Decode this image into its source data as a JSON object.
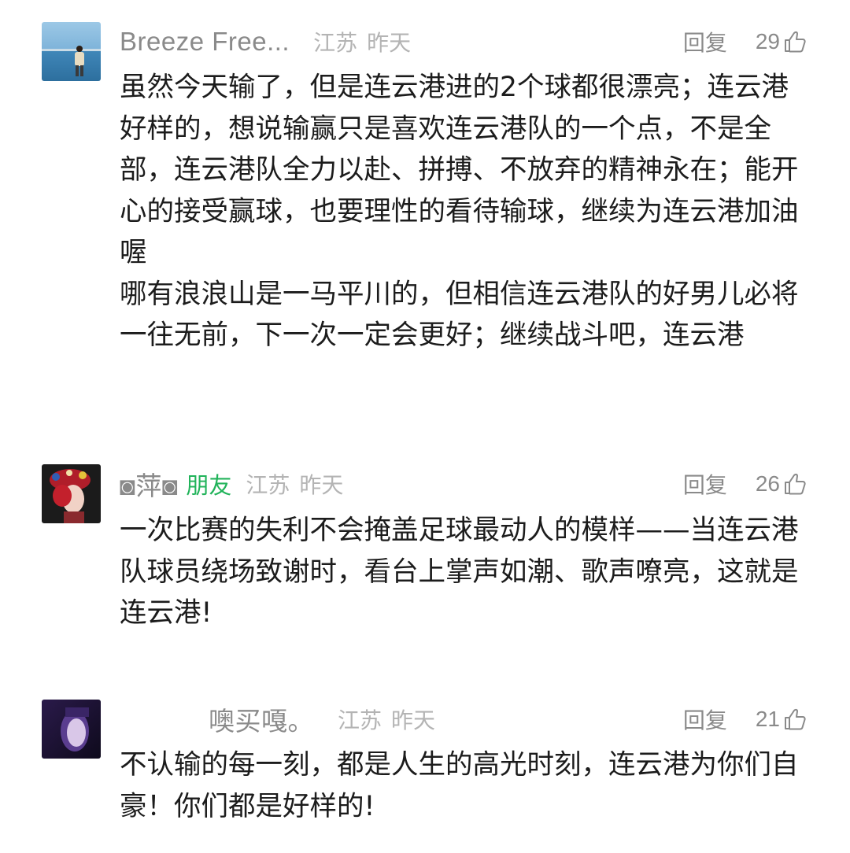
{
  "comments": [
    {
      "name": "Breeze Free...",
      "friend_badge": "",
      "location": "江苏",
      "time": "昨天",
      "reply_label": "回复",
      "likes": "29",
      "text": "虽然今天输了，但是连云港进的2个球都很漂亮；连云港好样的，想说输赢只是喜欢连云港队的一个点，不是全部，连云港队全力以赴、拼搏、不放弃的精神永在；能开心的接受赢球，也要理性的看待输球，继续为连云港加油喔\n哪有浪浪山是一马平川的，但相信连云港队的好男儿必将一往无前，下一次一定会更好；继续战斗吧，连云港"
    },
    {
      "name": "◙萍◙",
      "friend_badge": "朋友",
      "location": "江苏",
      "time": "昨天",
      "reply_label": "回复",
      "likes": "26",
      "text": "一次比赛的失利不会掩盖足球最动人的模样——当连云港队球员绕场致谢时，看台上掌声如潮、歌声嘹亮，这就是连云港!"
    },
    {
      "name": "噢买嘎。",
      "friend_badge": "",
      "location": "江苏",
      "time": "昨天",
      "reply_label": "回复",
      "likes": "21",
      "text": "不认输的每一刻，都是人生的高光时刻，连云港为你们自豪！你们都是好样的!"
    }
  ],
  "colors": {
    "meta_gray": "#8a8a8a",
    "light_gray": "#b4b4b4",
    "friend_green": "#21b35a",
    "text": "#1c1c1c"
  },
  "icons": {
    "like": "thumbs-up-icon"
  }
}
